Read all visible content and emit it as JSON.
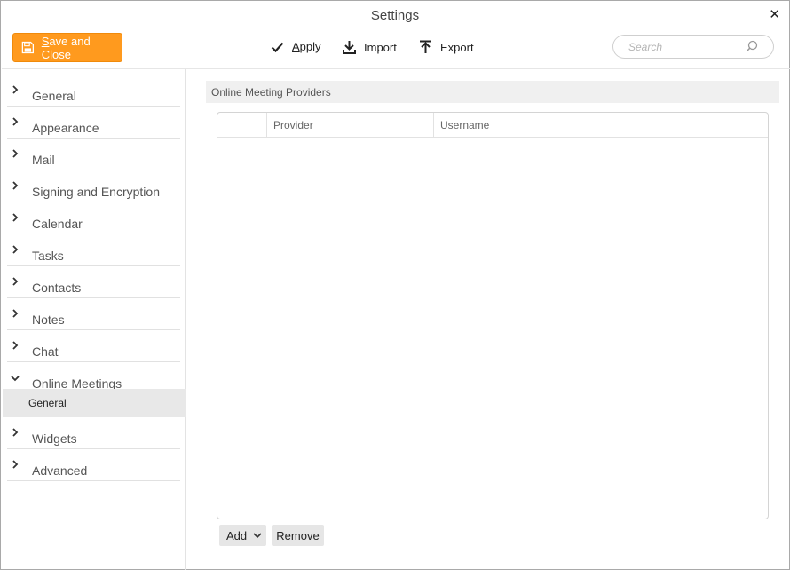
{
  "window": {
    "title": "Settings"
  },
  "toolbar": {
    "save_close_label": "Save and Close",
    "apply_label": "Apply",
    "import_label": "Import",
    "export_label": "Export",
    "search_placeholder": "Search"
  },
  "sidebar": {
    "items": [
      {
        "label": "General",
        "expanded": false
      },
      {
        "label": "Appearance",
        "expanded": false
      },
      {
        "label": "Mail",
        "expanded": false
      },
      {
        "label": "Signing and Encryption",
        "expanded": false
      },
      {
        "label": "Calendar",
        "expanded": false
      },
      {
        "label": "Tasks",
        "expanded": false
      },
      {
        "label": "Contacts",
        "expanded": false
      },
      {
        "label": "Notes",
        "expanded": false
      },
      {
        "label": "Chat",
        "expanded": false
      },
      {
        "label": "Online Meetings",
        "expanded": true,
        "children": [
          {
            "label": "General",
            "selected": true
          }
        ]
      },
      {
        "label": "Widgets",
        "expanded": false
      },
      {
        "label": "Advanced",
        "expanded": false
      }
    ]
  },
  "main": {
    "section_title": "Online Meeting Providers",
    "table": {
      "columns": [
        "",
        "Provider",
        "Username"
      ],
      "rows": []
    },
    "add_label": "Add",
    "remove_label": "Remove"
  },
  "colors": {
    "accent": "#ff9a1e",
    "selected_bg": "#e8e8e8"
  },
  "icons": {
    "save": "save-icon",
    "apply": "checkmark-icon",
    "import": "import-icon",
    "export": "export-icon",
    "search": "search-icon",
    "close": "close-icon"
  }
}
